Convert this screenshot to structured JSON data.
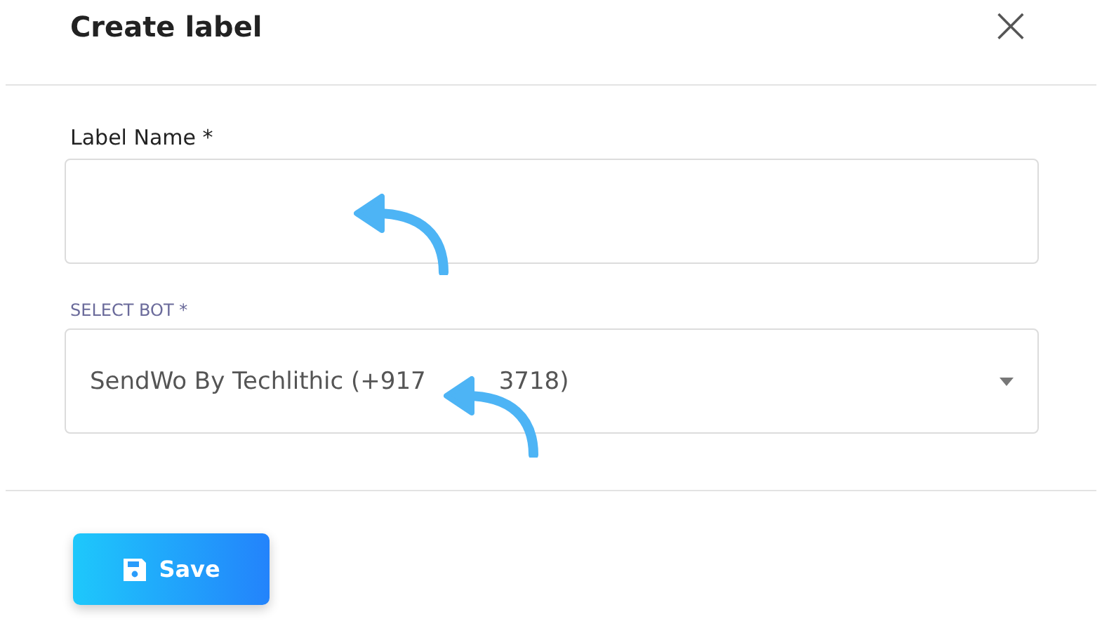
{
  "dialog": {
    "title": "Create label",
    "close": "×"
  },
  "fields": [
    {
      "label": "Label Name *",
      "kind": "text"
    },
    {
      "label": "SELECT BOT *",
      "kind": "select",
      "value_start": "SendWo By Techlithic (+917",
      "value_end": "3718)"
    }
  ],
  "buttons": [
    {
      "label": "Save"
    }
  ]
}
